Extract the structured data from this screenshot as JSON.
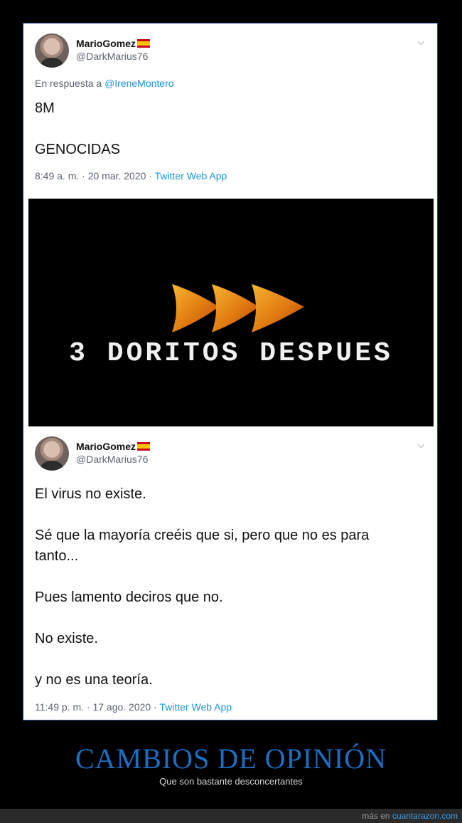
{
  "tweet1": {
    "display_name": "MarioGomez",
    "handle": "@DarkMarius76",
    "reply_prefix": "En respuesta a",
    "reply_mention": "@IreneMontero",
    "lines": [
      "8M",
      "GENOCIDAS"
    ],
    "timestamp": "8:49 a. m. · 20 mar. 2020 ·",
    "app": "Twitter Web App"
  },
  "image": {
    "caption": "3 DORITOS DESPUES"
  },
  "tweet2": {
    "display_name": "MarioGomez",
    "handle": "@DarkMarius76",
    "lines": [
      "El virus no existe.",
      "Sé que la mayoría creéis que si, pero que no es para",
      "tanto...",
      "Pues lamento deciros que no.",
      "No existe.",
      "y no es una teoría."
    ],
    "timestamp": "11:49 p. m. · 17 ago. 2020 ·",
    "app": "Twitter Web App"
  },
  "footer": {
    "title": "CAMBIOS DE OPINIÓN",
    "subtitle": "Que son bastante desconcertantes",
    "credit_prefix": "más en",
    "credit_link": "cuantarazon.com"
  },
  "icons": {
    "chevron": "chevron-down-icon",
    "flag": "spain-flag-icon"
  },
  "colors": {
    "link_blue": "#1b95e0",
    "footer_title": "#1b6fc2",
    "background": "#000000"
  }
}
